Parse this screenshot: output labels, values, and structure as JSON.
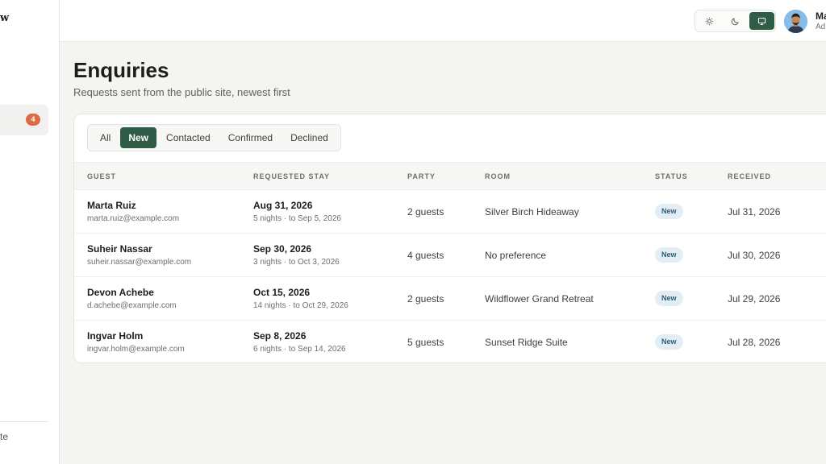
{
  "sidebar": {
    "brand": "w",
    "active_badge": "4",
    "footer_label": "te"
  },
  "topbar": {
    "theme_options": [
      "light-mode",
      "dark-mode",
      "system-mode"
    ],
    "active_theme": "system-mode",
    "user_name": "Ma",
    "user_role": "Ad"
  },
  "page": {
    "title": "Enquiries",
    "subtitle": "Requests sent from the public site, newest first"
  },
  "filters": {
    "tabs": [
      "All",
      "New",
      "Contacted",
      "Confirmed",
      "Declined"
    ],
    "active": "New"
  },
  "table": {
    "headers": [
      "GUEST",
      "REQUESTED STAY",
      "PARTY",
      "ROOM",
      "STATUS",
      "RECEIVED"
    ],
    "rows": [
      {
        "name": "Marta Ruiz",
        "email": "marta.ruiz@example.com",
        "date": "Aug 31, 2026",
        "stay": "5 nights · to Sep 5, 2026",
        "party": "2 guests",
        "room": "Silver Birch Hideaway",
        "status": "New",
        "received": "Jul 31, 2026"
      },
      {
        "name": "Suheir Nassar",
        "email": "suheir.nassar@example.com",
        "date": "Sep 30, 2026",
        "stay": "3 nights · to Oct 3, 2026",
        "party": "4 guests",
        "room": "No preference",
        "status": "New",
        "received": "Jul 30, 2026"
      },
      {
        "name": "Devon Achebe",
        "email": "d.achebe@example.com",
        "date": "Oct 15, 2026",
        "stay": "14 nights · to Oct 29, 2026",
        "party": "2 guests",
        "room": "Wildflower Grand Retreat",
        "status": "New",
        "received": "Jul 29, 2026"
      },
      {
        "name": "Ingvar Holm",
        "email": "ingvar.holm@example.com",
        "date": "Sep 8, 2026",
        "stay": "6 nights · to Sep 14, 2026",
        "party": "5 guests",
        "room": "Sunset Ridge Suite",
        "status": "New",
        "received": "Jul 28, 2026"
      }
    ]
  },
  "colors": {
    "accent": "#2f5c46",
    "badge": "#dd6a45",
    "status_new_bg": "#e2eef4"
  }
}
